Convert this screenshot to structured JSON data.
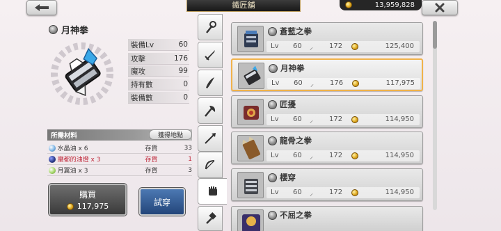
{
  "header": {
    "title": "鐵匠舖",
    "money": "13,959,828"
  },
  "selected": {
    "name": "月神拳",
    "stats": [
      {
        "label": "裝備Lv",
        "value": "60"
      },
      {
        "label": "攻擊",
        "value": "176"
      },
      {
        "label": "魔攻",
        "value": "99"
      },
      {
        "label": "持有數",
        "value": "0"
      },
      {
        "label": "裝備數",
        "value": "0"
      }
    ]
  },
  "materials": {
    "title": "所需材料",
    "acquire_label": "獲得地點",
    "items": [
      {
        "name": "水晶油 x 6",
        "stock_label": "存貨",
        "count": "33",
        "color": "#3a3a3a",
        "dot": "#7fb6e6"
      },
      {
        "name": "磨都的油燈 x 3",
        "stock_label": "存貨",
        "count": "1",
        "color": "#c0283a",
        "dot": "#2f3f8f"
      },
      {
        "name": "月翼油 x 3",
        "stock_label": "存貨",
        "count": "3",
        "color": "#3a3a3a",
        "dot": "#a6d86a"
      }
    ]
  },
  "buy": {
    "label": "購買",
    "price": "117,975"
  },
  "try_on": {
    "label": "試穿"
  },
  "tabs": [
    {
      "icon": "staff-icon",
      "active": false
    },
    {
      "icon": "sword-icon",
      "active": false
    },
    {
      "icon": "curved-blade-icon",
      "active": false
    },
    {
      "icon": "axe-icon",
      "active": false
    },
    {
      "icon": "spear-icon",
      "active": false
    },
    {
      "icon": "bow-icon",
      "active": false
    },
    {
      "icon": "fist-icon",
      "active": true
    },
    {
      "icon": "hammer-icon",
      "active": false
    }
  ],
  "weapons": [
    {
      "name": "蒼藍之拳",
      "lv_label": "Lv",
      "lv": "60",
      "atk": "172",
      "price": "125,400",
      "selected": false
    },
    {
      "name": "月神拳",
      "lv_label": "Lv",
      "lv": "60",
      "atk": "176",
      "price": "117,975",
      "selected": true
    },
    {
      "name": "匠擾",
      "lv_label": "Lv",
      "lv": "60",
      "atk": "172",
      "price": "114,950",
      "selected": false
    },
    {
      "name": "龍骨之拳",
      "lv_label": "Lv",
      "lv": "60",
      "atk": "172",
      "price": "114,950",
      "selected": false
    },
    {
      "name": "櫻穿",
      "lv_label": "Lv",
      "lv": "60",
      "atk": "172",
      "price": "114,950",
      "selected": false
    },
    {
      "name": "不屈之拳",
      "lv_label": "",
      "lv": "",
      "atk": "",
      "price": "",
      "selected": false
    }
  ]
}
